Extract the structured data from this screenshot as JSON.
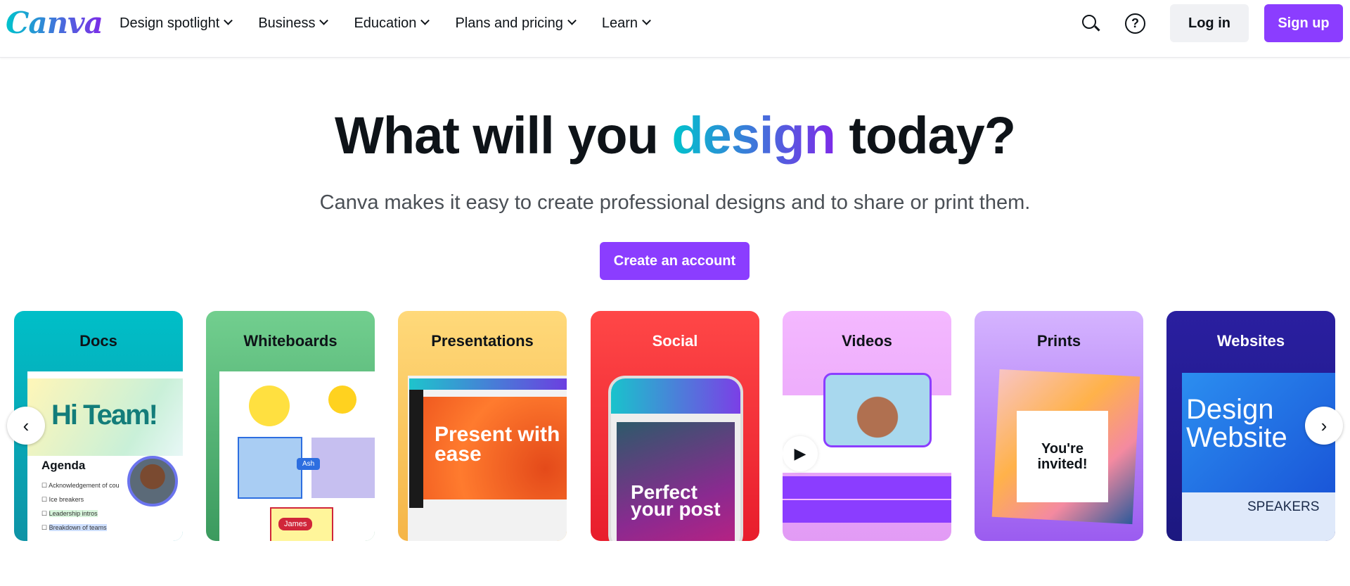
{
  "header": {
    "logo": "Canva",
    "nav": [
      {
        "label": "Design spotlight"
      },
      {
        "label": "Business"
      },
      {
        "label": "Education"
      },
      {
        "label": "Plans and pricing"
      },
      {
        "label": "Learn"
      }
    ],
    "help_symbol": "?",
    "login_label": "Log in",
    "signup_label": "Sign up"
  },
  "hero": {
    "title_before": "What will you ",
    "title_accent": "design",
    "title_after": " today?",
    "subtitle": "Canva makes it easy to create professional designs and to share or print them.",
    "cta_label": "Create an account"
  },
  "cards": [
    {
      "title": "Docs",
      "art": {
        "heading": "Hi Team!",
        "agenda": "Agenda",
        "items": [
          "Acknowledgement of cou",
          "Ice breakers",
          "Leadership intros",
          "Breakdown of teams"
        ]
      }
    },
    {
      "title": "Whiteboards",
      "art": {
        "tag1": "Ash",
        "tag2": "James"
      }
    },
    {
      "title": "Presentations",
      "art": {
        "text": "Present with ease"
      }
    },
    {
      "title": "Social",
      "art": {
        "text": "Perfect your post"
      }
    },
    {
      "title": "Videos"
    },
    {
      "title": "Prints",
      "art": {
        "text": "You're invited!"
      }
    },
    {
      "title": "Websites",
      "art": {
        "text": "Design Website",
        "speakers": "SPEAKERS"
      }
    }
  ],
  "carousel": {
    "prev": "‹",
    "next": "›"
  },
  "colors": {
    "brand": "#8b3dff",
    "accent_start": "#00c4cc",
    "accent_end": "#7d2ae8"
  }
}
